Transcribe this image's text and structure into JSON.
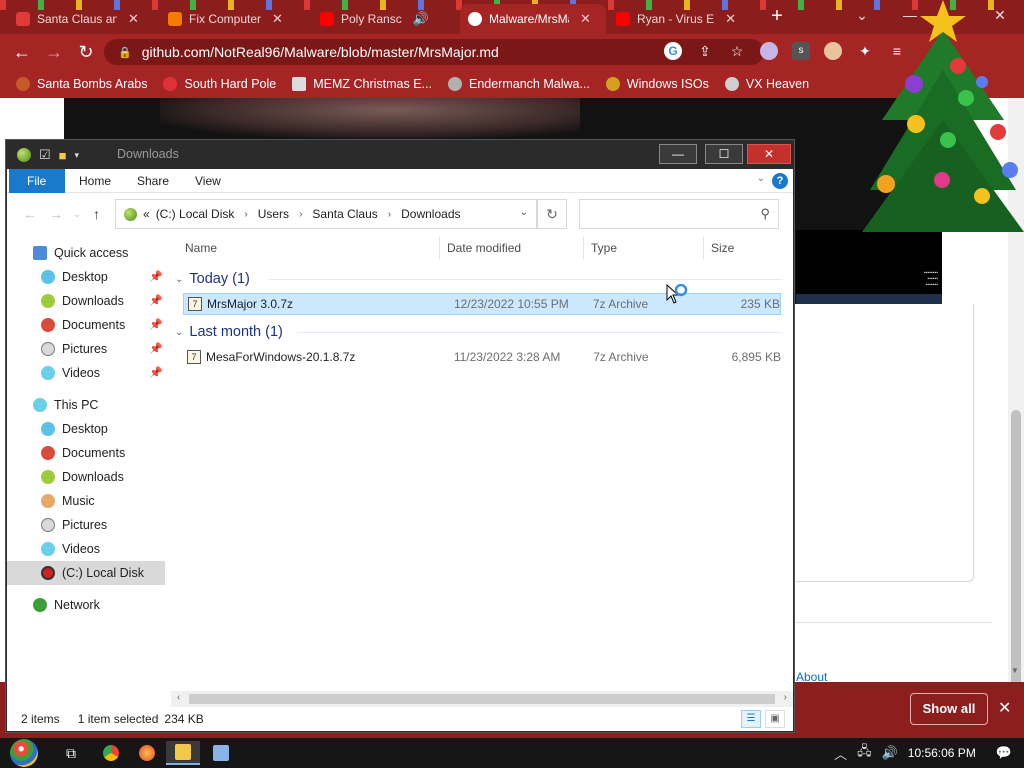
{
  "browser": {
    "tabs": [
      {
        "title": "Santa Claus and",
        "favicon_color": "#e23a3a",
        "active": false
      },
      {
        "title": "Fix Computer",
        "favicon_color": "#f57c00",
        "active": false
      },
      {
        "title": "Poly Ransc",
        "favicon_color": "#ff0000",
        "active": false
      },
      {
        "title": "Malware/MrsMa",
        "favicon_color": "#ffffff",
        "active": true
      },
      {
        "title": "Ryan - Virus E",
        "favicon_color": "#ff0000",
        "active": false
      }
    ],
    "url": "github.com/NotReal96/Malware/blob/master/MrsMajor.md",
    "bookmarks": [
      {
        "label": "Santa Bombs Arabs",
        "icon_color": "#c45a2a"
      },
      {
        "label": "South Hard Pole",
        "icon_color": "#e0303a"
      },
      {
        "label": "MEMZ Christmas E...",
        "icon_color": "#dcdcdc"
      },
      {
        "label": "Endermanch Malwa...",
        "icon_color": "#b0b0b0"
      },
      {
        "label": "Windows ISOs",
        "icon_color": "#d4a020"
      },
      {
        "label": "VX Heaven",
        "icon_color": "#cfcfcf"
      }
    ],
    "page": {
      "about_link": "About"
    },
    "download_bar": {
      "show_all": "Show all"
    }
  },
  "explorer": {
    "title": "Downloads",
    "ribbon_tabs": [
      "File",
      "Home",
      "Share",
      "View"
    ],
    "breadcrumb": [
      "(C:) Local Disk",
      "Users",
      "Santa Claus",
      "Downloads"
    ],
    "breadcrumb_prefix": "«",
    "nav_pane": {
      "quick_access": "Quick access",
      "quick_items": [
        "Desktop",
        "Downloads",
        "Documents",
        "Pictures",
        "Videos"
      ],
      "this_pc": "This PC",
      "pc_items": [
        "Desktop",
        "Documents",
        "Downloads",
        "Music",
        "Pictures",
        "Videos",
        "(C:) Local Disk"
      ],
      "network": "Network"
    },
    "columns": [
      "Name",
      "Date modified",
      "Type",
      "Size"
    ],
    "groups": [
      {
        "label": "Today (1)",
        "files": [
          {
            "name": "MrsMajor 3.0.7z",
            "date": "12/23/2022 10:55 PM",
            "type": "7z Archive",
            "size": "235 KB",
            "selected": true
          }
        ]
      },
      {
        "label": "Last month (1)",
        "files": [
          {
            "name": "MesaForWindows-20.1.8.7z",
            "date": "11/23/2022 3:28 AM",
            "type": "7z Archive",
            "size": "6,895 KB",
            "selected": false
          }
        ]
      }
    ],
    "status": {
      "items": "2 items",
      "selected": "1 item selected",
      "selected_size": "234 KB"
    }
  },
  "taskbar": {
    "time": "10:56:06 PM"
  },
  "colors": {
    "chrome_frame": "#a52424",
    "explorer_accent": "#1979ca",
    "selection": "#cce8ff"
  }
}
